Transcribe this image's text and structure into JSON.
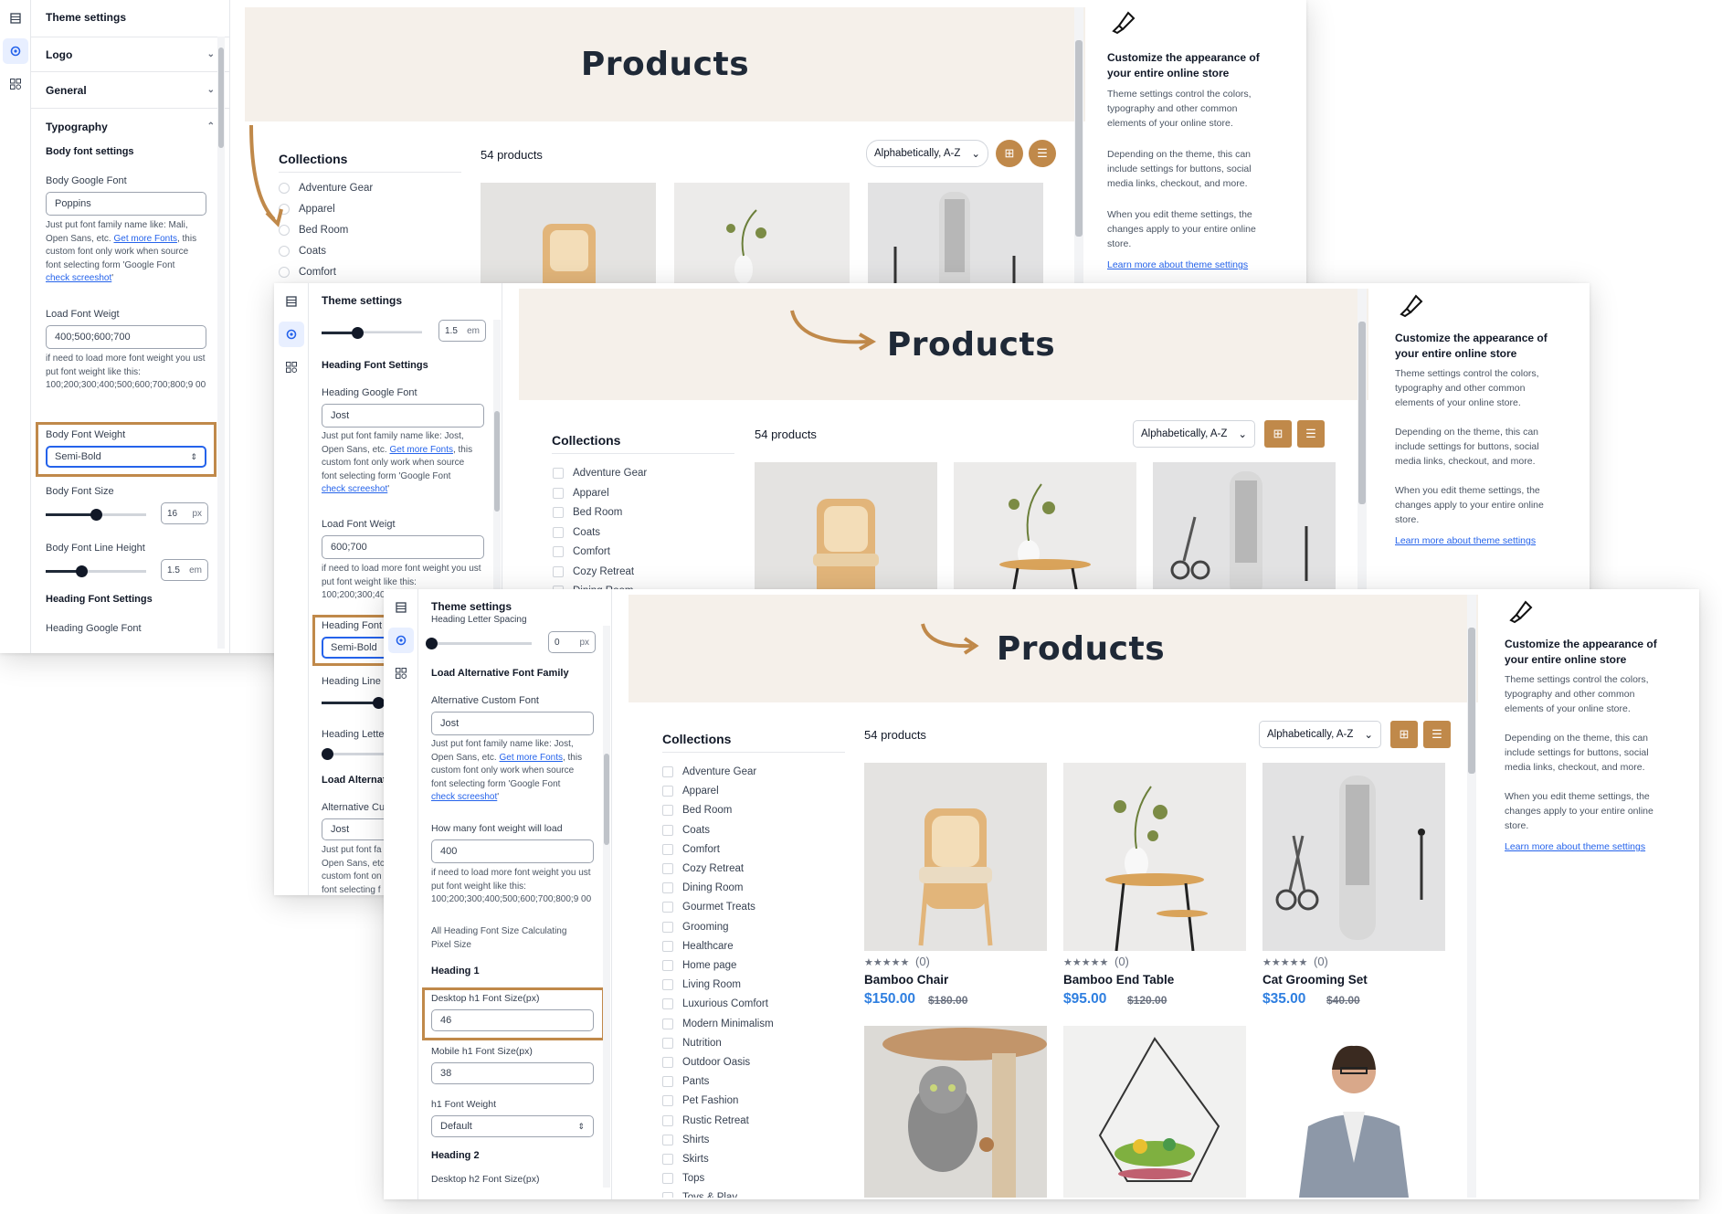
{
  "colors": {
    "accent": "#c0894a",
    "price": "#2f7fe0",
    "hero_bg": "#f5f0ea",
    "highlight": "#c0894a"
  },
  "windows": [
    {
      "panel": {
        "title": "Theme settings",
        "sections": [
          "Logo",
          "General",
          "Typography"
        ],
        "body_font_settings": "Body font settings",
        "body_google_font_label": "Body Google Font",
        "body_google_font_value": "Poppins",
        "help_font_a": "Just put font family name like: Mali,",
        "help_font_b": "Open Sans, etc.",
        "help_font_link": "Get more Fonts",
        "help_font_c": ", this",
        "help_font_d": "custom font only work when source",
        "help_font_e": "font selecting form 'Google Font",
        "help_font_link2": "check screeshot",
        "help_font_f": "'",
        "load_font_weight_label": "Load Font Weigt",
        "load_font_weight_value": "400;500;600;700",
        "help_weight": "if need to load more font weight you ust put font weight like this: 100;200;300;400;500;600;700;800;9 00",
        "body_font_weight_label": "Body Font Weight",
        "body_font_weight_value": "Semi-Bold",
        "body_font_size_label": "Body Font Size",
        "body_font_size_value": "16",
        "body_font_size_unit": "px",
        "body_font_size_level": 0.5,
        "body_line_height_label": "Body Font Line Height",
        "body_line_height_value": "1.5",
        "body_line_height_unit": "em",
        "body_line_height_level": 0.35,
        "heading_font_settings": "Heading Font Settings",
        "heading_google_font_label": "Heading Google Font"
      },
      "store": {
        "title": "Products",
        "collections_title": "Collections",
        "collections": [
          "Adventure Gear",
          "Apparel",
          "Bed Room",
          "Coats",
          "Comfort"
        ],
        "count": "54 products",
        "sort": "Alphabetically, A-Z"
      },
      "info": {
        "title": "Customize the appearance of your entire online store",
        "p1": "Theme settings control the colors, typography and other common elements of your online store.",
        "p2": "Depending on the theme, this can include settings for buttons, social media links, checkout, and more.",
        "p3": "When you edit theme settings, the changes apply to your entire online store.",
        "link": "Learn more about theme settings"
      }
    },
    {
      "panel": {
        "title": "Theme settings",
        "top_value": "1.5",
        "top_unit": "em",
        "top_level": 0.35,
        "heading_font_settings": "Heading Font Settings",
        "heading_google_font_label": "Heading Google Font",
        "heading_google_font_value": "Jost",
        "help_font_a": "Just put font family name like: Jost,",
        "help_font_b": "Open Sans, etc.",
        "help_font_link": "Get more Fonts",
        "help_font_c": ", this",
        "help_font_d": "custom font only work when source",
        "help_font_e": "font selecting form 'Google Font",
        "help_font_link2": "check screeshot",
        "help_font_f": "'",
        "load_font_weight_label": "Load Font Weigt",
        "load_font_weight_value": "600;700",
        "help_weight": "if need to load more font weight you ust put font weight like this: 100;200;300;400;500;600;700;800;9 00",
        "heading_font_weight_label": "Heading Font V",
        "heading_font_weight_value": "Semi-Bold",
        "heading_line_label": "Heading Line H",
        "heading_letter_label": "Heading Letter",
        "load_alt_label": "Load Alternati",
        "alt_custom_label": "Alternative Cus",
        "alt_value": "Jost",
        "help_cut_a": "Just put font fa",
        "help_cut_b": "Open Sans, etc",
        "help_cut_c": "custom font on",
        "help_cut_d": "font selecting f"
      },
      "store": {
        "title": "Products",
        "collections_title": "Collections",
        "collections": [
          "Adventure Gear",
          "Apparel",
          "Bed Room",
          "Coats",
          "Comfort",
          "Cozy Retreat",
          "Dining Room"
        ],
        "count": "54 products",
        "sort": "Alphabetically, A-Z"
      },
      "info": {
        "title": "Customize the appearance of your entire online store",
        "p1": "Theme settings control the colors, typography and other common elements of your online store.",
        "p2": "Depending on the theme, this can include settings for buttons, social media links, checkout, and more.",
        "p3": "When you edit theme settings, the changes apply to your entire online store.",
        "link": "Learn more about theme settings"
      }
    },
    {
      "panel": {
        "title": "Theme settings",
        "top_label": "Heading Letter Spacing",
        "top_value": "0",
        "top_unit": "px",
        "top_level": 0.0,
        "load_alt_title": "Load Alternative Font Family",
        "alt_custom_label": "Alternative Custom Font",
        "alt_value": "Jost",
        "help_font_a": "Just put font family name like: Jost,",
        "help_font_b": "Open Sans, etc.",
        "help_font_link": "Get more Fonts",
        "help_font_c": ", this",
        "help_font_d": "custom font only work when source",
        "help_font_e": "font selecting form 'Google Font",
        "help_font_link2": "check screeshot",
        "help_font_f": "'",
        "how_many_label": "How many font weight will load",
        "how_many_value": "400",
        "help_weight": "if need to load more font weight you ust put font weight like this: 100;200;300;400;500;600;700;800;9 00",
        "calc_label": "All Heading Font Size Calculating Pixel Size",
        "heading1": "Heading 1",
        "desktop_h1_label": "Desktop h1 Font Size(px)",
        "desktop_h1_value": "46",
        "mobile_h1_label": "Mobile h1 Font Size(px)",
        "mobile_h1_value": "38",
        "h1_weight_label": "h1 Font Weight",
        "h1_weight_value": "Default",
        "heading2": "Heading 2",
        "desktop_h2_label": "Desktop h2 Font Size(px)"
      },
      "store": {
        "title": "Products",
        "collections_title": "Collections",
        "collections": [
          "Adventure Gear",
          "Apparel",
          "Bed Room",
          "Coats",
          "Comfort",
          "Cozy Retreat",
          "Dining Room",
          "Gourmet Treats",
          "Grooming",
          "Healthcare",
          "Home page",
          "Living Room",
          "Luxurious Comfort",
          "Modern Minimalism",
          "Nutrition",
          "Outdoor Oasis",
          "Pants",
          "Pet Fashion",
          "Rustic Retreat",
          "Shirts",
          "Skirts",
          "Tops",
          "Toys & Play"
        ],
        "count": "54 products",
        "sort": "Alphabetically, A-Z",
        "products": [
          {
            "stars": "★★★★★",
            "reviews": "(0)",
            "name": "Bamboo Chair",
            "price": "$150.00",
            "old": "$180.00"
          },
          {
            "stars": "★★★★★",
            "reviews": "(0)",
            "name": "Bamboo End Table",
            "price": "$95.00",
            "old": "$120.00"
          },
          {
            "stars": "★★★★★",
            "reviews": "(0)",
            "name": "Cat Grooming Set",
            "price": "$35.00",
            "old": "$40.00"
          }
        ]
      },
      "info": {
        "title": "Customize the appearance of your entire online store",
        "p1": "Theme settings control the colors, typography and other common elements of your online store.",
        "p2": "Depending on the theme, this can include settings for buttons, social media links, checkout, and more.",
        "p3": "When you edit theme settings, the changes apply to your entire online store.",
        "link": "Learn more about theme settings"
      }
    }
  ]
}
